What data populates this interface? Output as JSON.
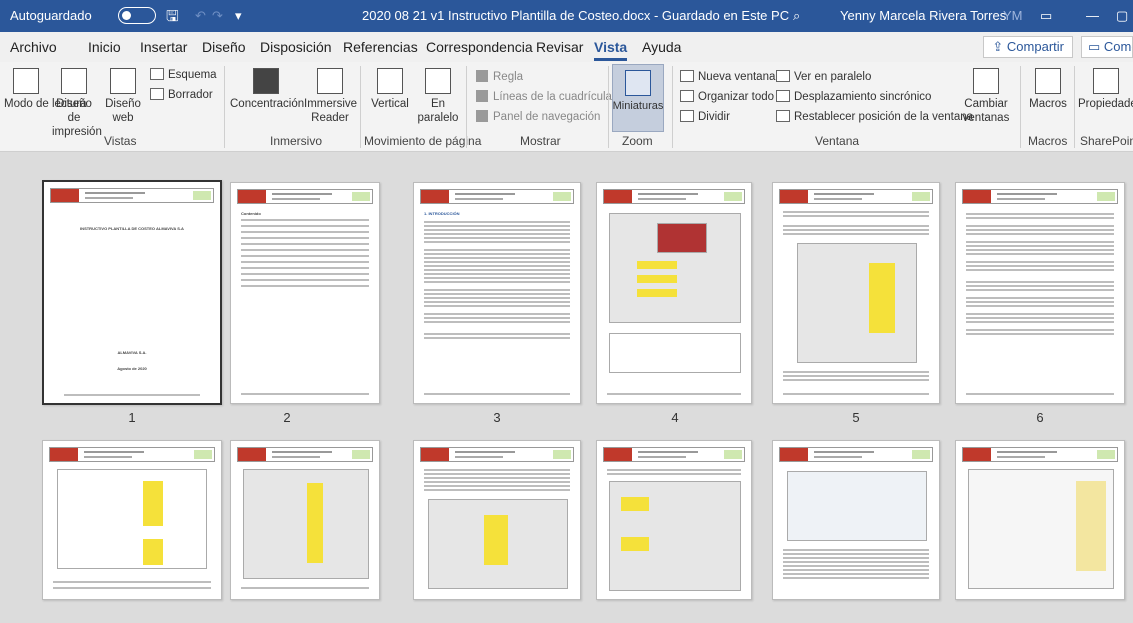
{
  "titlebar": {
    "autosave_label": "Autoguardado",
    "document_title": "2020 08 21 v1 Instructivo Plantilla de Costeo.docx - Guardado en Este PC",
    "user_name": "Yenny Marcela Rivera Torres",
    "user_initials": "YM"
  },
  "menu": {
    "tabs": [
      "Archivo",
      "Inicio",
      "Insertar",
      "Diseño",
      "Disposición",
      "Referencias",
      "Correspondencia",
      "Revisar",
      "Vista",
      "Ayuda"
    ],
    "active_tab": "Vista",
    "share_label": "Compartir",
    "comments_label": "Comentarios"
  },
  "ribbon": {
    "vistas": {
      "group_label": "Vistas",
      "modo_lectura": "Modo de lectura",
      "diseno_impresion": "Diseño de impresión",
      "diseno_web": "Diseño web",
      "esquema": "Esquema",
      "borrador": "Borrador"
    },
    "inmersivo": {
      "group_label": "Inmersivo",
      "concentracion": "Concentración",
      "lector_inmersivo": "Immersive Reader"
    },
    "movimiento": {
      "group_label": "Movimiento de página",
      "vertical": "Vertical",
      "en_paralelo": "En paralelo"
    },
    "mostrar": {
      "group_label": "Mostrar",
      "regla": "Regla",
      "lineas": "Líneas de la cuadrícula",
      "panel": "Panel de navegación"
    },
    "zoom": {
      "group_label": "Zoom",
      "miniaturas": "Miniaturas"
    },
    "ventana": {
      "group_label": "Ventana",
      "nueva_ventana": "Nueva ventana",
      "organizar_todo": "Organizar todo",
      "dividir": "Dividir",
      "ver_en_paralelo": "Ver en paralelo",
      "desplazamiento": "Desplazamiento sincrónico",
      "restablecer": "Restablecer posición de la ventana",
      "cambiar_ventanas": "Cambiar ventanas"
    },
    "macros": {
      "group_label": "Macros",
      "macros": "Macros"
    },
    "sharepoint": {
      "group_label": "SharePoint",
      "propiedades": "Propiedades"
    }
  },
  "pages": {
    "numbers": [
      "1",
      "2",
      "3",
      "4",
      "5",
      "6"
    ],
    "page1_title": "INSTRUCTIVO PLANTILLA DE COSTEO ALMAVIVA S.A",
    "page1_company": "ALMAVIVA S.A.",
    "page1_date": "Agosto de 2020",
    "page2_heading": "Contenido",
    "page3_heading": "1. INTRODUCCIÓN"
  },
  "colors": {
    "titlebar": "#2b579a",
    "highlight_yellow": "#f5e13a",
    "logo_red": "#c0392b"
  }
}
